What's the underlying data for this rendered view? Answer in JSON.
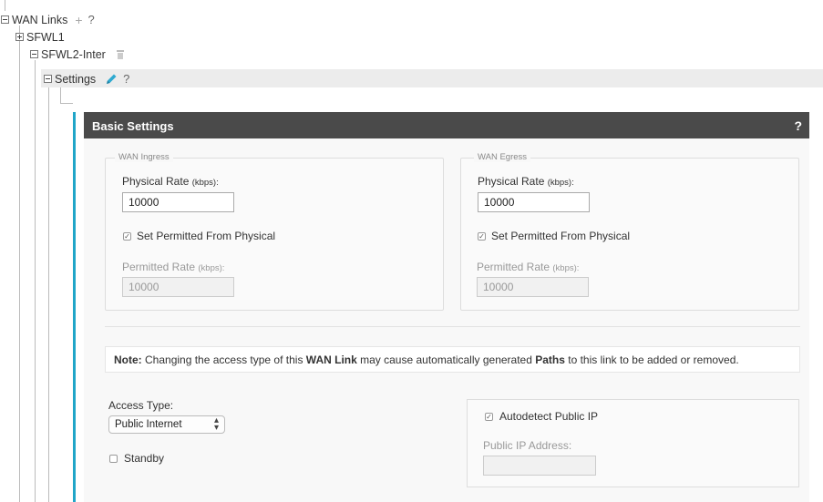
{
  "tree": {
    "root_label": "WAN Links",
    "root_add": "+",
    "root_help": "?",
    "child1_label": "SFWL1",
    "child2_label": "SFWL2-Inter",
    "settings_label": "Settings",
    "settings_help": "?"
  },
  "panel": {
    "title": "Basic Settings",
    "help": "?",
    "ingress": {
      "legend": "WAN Ingress",
      "physical_label": "Physical Rate ",
      "physical_unit": "(kbps):",
      "physical_value": "10000",
      "set_permitted_label": "Set Permitted From Physical",
      "set_permitted_checked": true,
      "permitted_label": "Permitted Rate ",
      "permitted_unit": "(kbps):",
      "permitted_value": "10000"
    },
    "egress": {
      "legend": "WAN Egress",
      "physical_label": "Physical Rate ",
      "physical_unit": "(kbps):",
      "physical_value": "10000",
      "set_permitted_label": "Set Permitted From Physical",
      "set_permitted_checked": true,
      "permitted_label": "Permitted Rate ",
      "permitted_unit": "(kbps):",
      "permitted_value": "10000"
    },
    "note": {
      "prefix": "Note:",
      "t1": " Changing the access type of this ",
      "b1": "WAN Link",
      "t2": " may cause automatically generated ",
      "b2": "Paths",
      "t3": " to this link to be added or removed."
    },
    "access_type": {
      "label": "Access Type:",
      "selected": "Public Internet",
      "arrows": "▲▼"
    },
    "standby": {
      "label": "Standby",
      "checked": false
    },
    "autodetect": {
      "label": "Autodetect Public IP",
      "checked": true
    },
    "public_ip": {
      "label": "Public IP Address:",
      "value": ""
    }
  },
  "colors": {
    "accent": "#20a5c8",
    "header_bg": "#4a4a4a"
  },
  "icons": [
    "collapse-icon",
    "expand-icon",
    "add-icon",
    "help-icon",
    "trash-icon",
    "pencil-icon"
  ]
}
